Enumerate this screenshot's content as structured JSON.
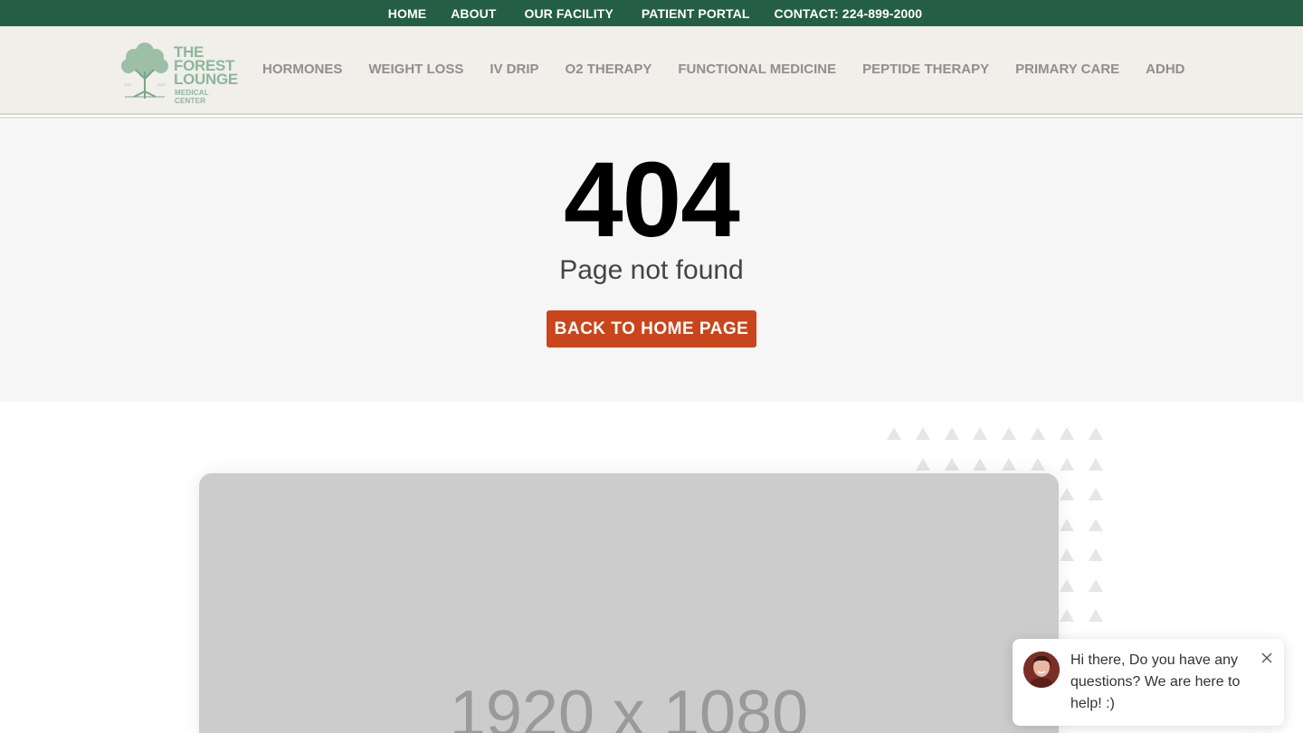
{
  "topbar": {
    "home": "HOME",
    "about": "ABOUT",
    "facility": "OUR FACILITY",
    "portal": "PATIENT PORTAL",
    "contact": "CONTACT: 224-899-2000"
  },
  "logo": {
    "line1": "THE",
    "line2": "FOREST",
    "line3": "LOUNGE",
    "line4": "MEDICAL CENTER"
  },
  "nav": {
    "items": [
      "HORMONES",
      "WEIGHT LOSS",
      "IV DRIP",
      "O2 THERAPY",
      "FUNCTIONAL MEDICINE",
      "PEPTIDE THERAPY",
      "PRIMARY CARE",
      "ADHD"
    ]
  },
  "error": {
    "code": "404",
    "message": "Page not found",
    "button": "BACK TO HOME PAGE"
  },
  "placeholder": {
    "text": "1920 x 1080"
  },
  "chat": {
    "message": "Hi there, Do you have any questions? We are here to help! :)"
  },
  "colors": {
    "topbar": "#245f45",
    "accent": "#c9451b",
    "logo": "#8db69a"
  },
  "icons": [
    "tree-logo-icon",
    "close-icon",
    "avatar"
  ]
}
